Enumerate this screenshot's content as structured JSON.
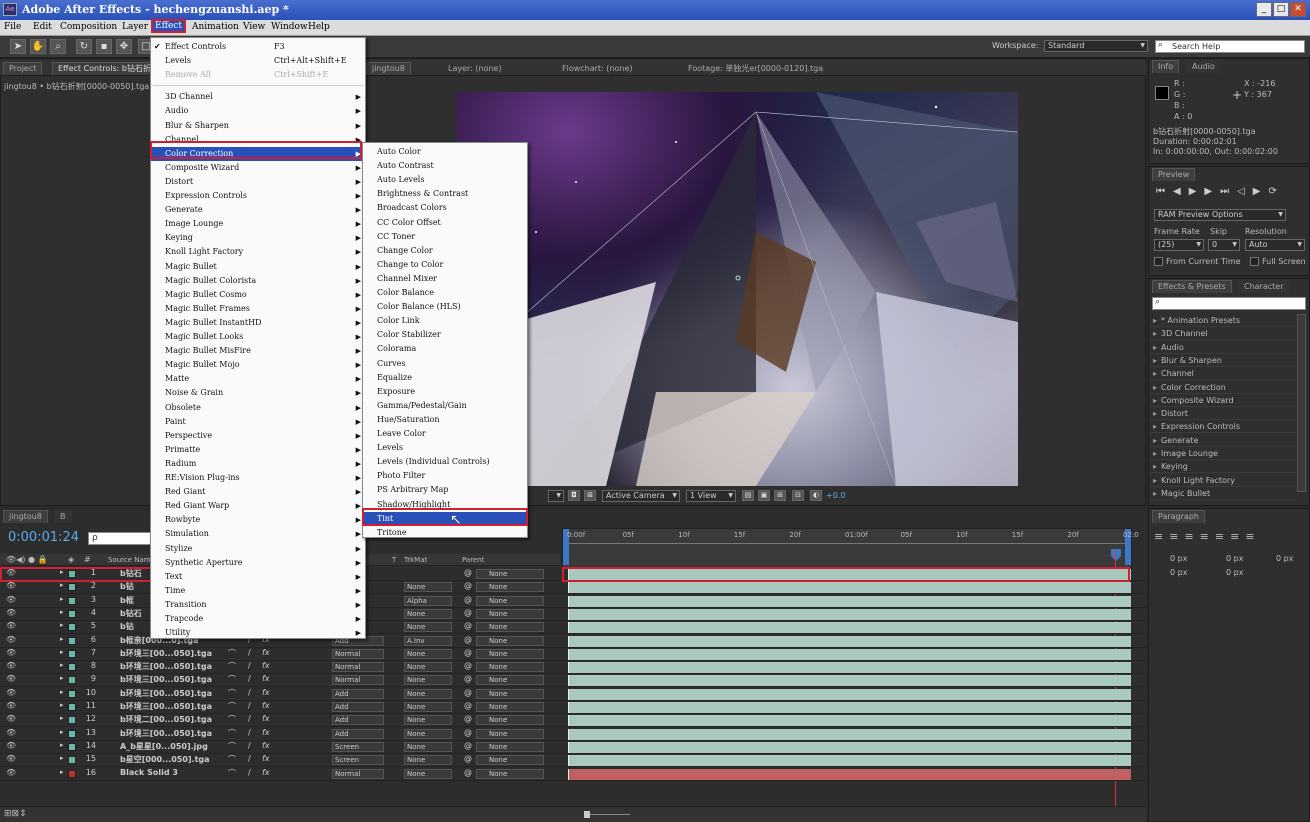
{
  "title": "Adobe After Effects - hechengzuanshi.aep *",
  "app_icon": "Ae",
  "window_buttons": [
    "_",
    "□",
    "✕"
  ],
  "menubar": [
    "File",
    "Edit",
    "Composition",
    "Layer",
    "Effect",
    "Animation",
    "View",
    "Window",
    "Help"
  ],
  "workspace": {
    "label": "Workspace:",
    "value": "Standard",
    "search_placeholder": "Search Help"
  },
  "tabs": {
    "project": "Project",
    "effect_controls": "Effect Controls: b钻石折射[0000-0050].tga",
    "comp": "jingtou8",
    "layer": "Layer: (none)",
    "flowchart": "Flowchart: (none)",
    "footage": "Footage: 单独光er[0000-0120].tga"
  },
  "project_path": "jingtou8 • b钻石折射[0000-0050].tga",
  "info_panel": {
    "tabs": [
      "Info",
      "Audio"
    ],
    "r": "R :",
    "g": "G :",
    "b": "B :",
    "a": "A : 0",
    "x": "X : -216",
    "y": "Y : 367",
    "file": "b钻石折射[0000-0050].tga",
    "duration": "Duration: 0:00:02:01",
    "inout": "In: 0:00:00:00, Out: 0:00:02:00"
  },
  "preview_panel": {
    "tab": "Preview",
    "ram": "RAM Preview Options",
    "frame_rate_label": "Frame Rate",
    "skip_label": "Skip",
    "resolution_label": "Resolution",
    "frame_rate": "(25)",
    "skip": "0",
    "resolution": "Auto",
    "from_current": "From Current Time",
    "full_screen": "Full Screen"
  },
  "effects_presets": {
    "tabs": [
      "Effects & Presets",
      "Character"
    ],
    "items": [
      "* Animation Presets",
      "3D Channel",
      "Audio",
      "Blur & Sharpen",
      "Channel",
      "Color Correction",
      "Composite Wizard",
      "Distort",
      "Expression Controls",
      "Generate",
      "Image Lounge",
      "Keying",
      "Knoll Light Factory",
      "Magic Bullet"
    ]
  },
  "paragraph_panel": {
    "tab": "Paragraph",
    "vals": [
      "0 px",
      "0 px",
      "0 px",
      "0 px",
      "0 px"
    ]
  },
  "viewer_controls": {
    "camera": "Active Camera",
    "view": "1 View",
    "exposure": "+0.0"
  },
  "timeline": {
    "tabs": [
      "jingtou8",
      "B"
    ],
    "timecode": "0:00:01:24",
    "search_placeholder": "ρ",
    "headers": {
      "source": "Source Name",
      "t": "T",
      "trkmat": "TrkMat",
      "parent": "Parent"
    },
    "ruler": [
      "0:00f",
      "05f",
      "10f",
      "15f",
      "20f",
      "01:00f",
      "05f",
      "10f",
      "15f",
      "20f",
      "02:0"
    ],
    "layers": [
      {
        "num": "1",
        "name": "b钻石",
        "mode": "",
        "trk": "",
        "parent": "None",
        "color": "#6ab8a8"
      },
      {
        "num": "2",
        "name": "b钻",
        "mode": "",
        "trk": "None",
        "parent": "None",
        "color": "#6ab8a8"
      },
      {
        "num": "3",
        "name": "b框",
        "mode": "",
        "trk": "Alpha",
        "parent": "None",
        "color": "#6ab8a8"
      },
      {
        "num": "4",
        "name": "b钻石",
        "mode": "",
        "trk": "None",
        "parent": "None",
        "color": "#6ab8a8"
      },
      {
        "num": "5",
        "name": "b钻",
        "mode": "",
        "trk": "None",
        "parent": "None",
        "color": "#6ab8a8"
      },
      {
        "num": "6",
        "name": "b框亲[000...0].tga",
        "mode": "Add",
        "trk": "A.Inv",
        "parent": "None",
        "color": "#6ab8a8"
      },
      {
        "num": "7",
        "name": "b环境三[00...050].tga",
        "mode": "Normal",
        "trk": "None",
        "parent": "None",
        "color": "#6ab8a8"
      },
      {
        "num": "8",
        "name": "b环境三[00...050].tga",
        "mode": "Normal",
        "trk": "None",
        "parent": "None",
        "color": "#6ab8a8"
      },
      {
        "num": "9",
        "name": "b环境三[00...050].tga",
        "mode": "Normal",
        "trk": "None",
        "parent": "None",
        "color": "#6ab8a8"
      },
      {
        "num": "10",
        "name": "b环境三[00...050].tga",
        "mode": "Add",
        "trk": "None",
        "parent": "None",
        "color": "#6ab8a8"
      },
      {
        "num": "11",
        "name": "b环境三[00...050].tga",
        "mode": "Add",
        "trk": "None",
        "parent": "None",
        "color": "#6ab8a8"
      },
      {
        "num": "12",
        "name": "b环境二[00...050].tga",
        "mode": "Add",
        "trk": "None",
        "parent": "None",
        "color": "#6ab8a8"
      },
      {
        "num": "13",
        "name": "b环境三[00...050].tga",
        "mode": "Add",
        "trk": "None",
        "parent": "None",
        "color": "#6ab8a8"
      },
      {
        "num": "14",
        "name": "A_b星星[0...050].jpg",
        "mode": "Screen",
        "trk": "None",
        "parent": "None",
        "color": "#6ab8a8"
      },
      {
        "num": "15",
        "name": "b星空[000...050].tga",
        "mode": "Screen",
        "trk": "None",
        "parent": "None",
        "color": "#6ab8a8"
      },
      {
        "num": "16",
        "name": "Black Solid 3",
        "mode": "Normal",
        "trk": "None",
        "parent": "None",
        "color": "#c03030"
      }
    ]
  },
  "effect_menu": [
    {
      "label": "Effect Controls",
      "shortcut": "F3",
      "check": true
    },
    {
      "label": "Levels",
      "shortcut": "Ctrl+Alt+Shift+E"
    },
    {
      "label": "Remove All",
      "shortcut": "Ctrl+Shift+E",
      "disabled": true
    },
    {
      "sep": true
    },
    {
      "label": "3D Channel",
      "sub": true
    },
    {
      "label": "Audio",
      "sub": true
    },
    {
      "label": "Blur & Sharpen",
      "sub": true
    },
    {
      "label": "Channel",
      "sub": true
    },
    {
      "label": "Color Correction",
      "sub": true,
      "hl": true
    },
    {
      "label": "Composite Wizard",
      "sub": true
    },
    {
      "label": "Distort",
      "sub": true
    },
    {
      "label": "Expression Controls",
      "sub": true
    },
    {
      "label": "Generate",
      "sub": true
    },
    {
      "label": "Image Lounge",
      "sub": true
    },
    {
      "label": "Keying",
      "sub": true
    },
    {
      "label": "Knoll Light Factory",
      "sub": true
    },
    {
      "label": "Magic Bullet",
      "sub": true
    },
    {
      "label": "Magic Bullet Colorista",
      "sub": true
    },
    {
      "label": "Magic Bullet Cosmo",
      "sub": true
    },
    {
      "label": "Magic Bullet Frames",
      "sub": true
    },
    {
      "label": "Magic Bullet InstantHD",
      "sub": true
    },
    {
      "label": "Magic Bullet Looks",
      "sub": true
    },
    {
      "label": "Magic Bullet MisFire",
      "sub": true
    },
    {
      "label": "Magic Bullet Mojo",
      "sub": true
    },
    {
      "label": "Matte",
      "sub": true
    },
    {
      "label": "Noise & Grain",
      "sub": true
    },
    {
      "label": "Obsolete",
      "sub": true
    },
    {
      "label": "Paint",
      "sub": true
    },
    {
      "label": "Perspective",
      "sub": true
    },
    {
      "label": "Primatte",
      "sub": true
    },
    {
      "label": "Radium",
      "sub": true
    },
    {
      "label": "RE:Vision Plug-ins",
      "sub": true
    },
    {
      "label": "Red Giant",
      "sub": true
    },
    {
      "label": "Red Giant Warp",
      "sub": true
    },
    {
      "label": "Rowbyte",
      "sub": true
    },
    {
      "label": "Simulation",
      "sub": true
    },
    {
      "label": "Stylize",
      "sub": true
    },
    {
      "label": "Synthetic Aperture",
      "sub": true
    },
    {
      "label": "Text",
      "sub": true
    },
    {
      "label": "Time",
      "sub": true
    },
    {
      "label": "Transition",
      "sub": true
    },
    {
      "label": "Trapcode",
      "sub": true
    },
    {
      "label": "Utility",
      "sub": true
    }
  ],
  "color_correction_menu": [
    "Auto Color",
    "Auto Contrast",
    "Auto Levels",
    "Brightness & Contrast",
    "Broadcast Colors",
    "CC Color Offset",
    "CC Toner",
    "Change Color",
    "Change to Color",
    "Channel Mixer",
    "Color Balance",
    "Color Balance (HLS)",
    "Color Link",
    "Color Stabilizer",
    "Colorama",
    "Curves",
    "Equalize",
    "Exposure",
    "Gamma/Pedestal/Gain",
    "Hue/Saturation",
    "Leave Color",
    "Levels",
    "Levels (Individual Controls)",
    "Photo Filter",
    "PS Arbitrary Map",
    "Shadow/Highlight",
    "Tint",
    "Tritone"
  ],
  "highlighted_submenu_item": "Tint"
}
